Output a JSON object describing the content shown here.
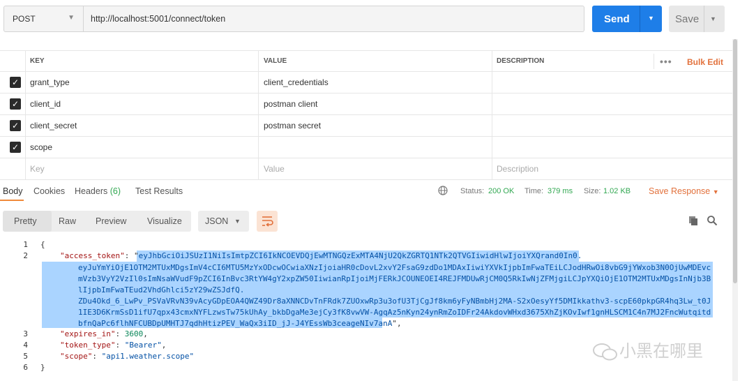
{
  "request": {
    "method": "POST",
    "url": "http://localhost:5001/connect/token",
    "send_label": "Send",
    "save_label": "Save"
  },
  "params": {
    "headers": {
      "key": "KEY",
      "value": "VALUE",
      "description": "DESCRIPTION",
      "bulk_edit": "Bulk Edit"
    },
    "rows": [
      {
        "key": "grant_type",
        "value": "client_credentials",
        "checked": true
      },
      {
        "key": "client_id",
        "value": "postman client",
        "checked": true
      },
      {
        "key": "client_secret",
        "value": "postman secret",
        "checked": true
      },
      {
        "key": "scope",
        "value": "",
        "checked": true
      }
    ],
    "placeholder": {
      "key": "Key",
      "value": "Value",
      "description": "Description"
    }
  },
  "response_tabs": {
    "body": "Body",
    "cookies": "Cookies",
    "headers": "Headers",
    "headers_count": "(6)",
    "test_results": "Test Results"
  },
  "response_status": {
    "status_label": "Status:",
    "status_value": "200 OK",
    "time_label": "Time:",
    "time_value": "379 ms",
    "size_label": "Size:",
    "size_value": "1.02 KB",
    "save_response": "Save Response"
  },
  "view_modes": {
    "pretty": "Pretty",
    "raw": "Raw",
    "preview": "Preview",
    "visualize": "Visualize",
    "format": "JSON"
  },
  "code": {
    "line1": "{",
    "k_access": "\"access_token\"",
    "colon_sp": ": \"",
    "tok1": "eyJhbGciOiJSUzI1NiIsImtpZCI6IkNCOEVDQjEwMTNGQzExMTA4NjU2QkZGRTQ1NTk2QTVGIiwidHlwIjoiYXQrand0In0.",
    "tok2": "eyJuYmYiOjE1OTM2MTUxMDgsImV4cCI6MTU5MzYxODcwOCwiaXNzIjoiaHR0cDovL2xvY2FsaG9zdDo1MDAxIiwiYXVkIjpbImFwaTEiLCJodHRwOi8vbG9jYWxob3N0OjUwMDEvcmVzb3VyY2VzIl0sImNsaWVudF9pZCI6InBvc3RtYW4gY2xpZW50IiwianRpIjoiMjFERkJCOUNEOEI4REJFMDUwRjCM0Q5RkIwNjZFMjgiLCJpYXQiOjE1OTM2MTUxMDgsInNjb3BlIjpbImFwaTEud2VhdGhlci5zY29wZSJdfQ.",
    "tok3": "ZDu4Okd_6_LwPv_PSVaVRvN39vAcyGDpEOA4QWZ49Dr8aXNNCDvTnFRdk7ZUOxwRp3u3ofU3TjCgJf8km6yFyNBmbHj2MA-S2xOesyYf5DMIkkathv3-scpE60pkpGR4hq3Lw_t0J1IE3D6KrmSsD1ifU7qpx43cmxNYFLzwsTw75kUhAy_bkbDgaMe3ejCy3fK8vwVW-AgqAz5nKyn24ynRmZoIDFr24AkdovWHxd3675XhZjKOvIwf1gnHLSCM1C4n7MJ2FncWutqitdbfnQaPc6flhNFCUBDpUMHTJ7qdhHtizPEV_WaQx3iID_jJ-J4YEssWb3ceageNIv7anA",
    "comma": "\",",
    "k_expires": "\"expires_in\"",
    "v_expires": "3600",
    "k_type": "\"token_type\"",
    "v_type": "\"Bearer\"",
    "k_scope": "\"scope\"",
    "v_scope": "\"api1.weather.scope\"",
    "line_last": "}",
    "line_numbers": [
      "1",
      "2",
      "3",
      "4",
      "5",
      "6"
    ]
  },
  "watermark": "小黑在哪里",
  "colors": {
    "accent": "#1e7ee8",
    "orange": "#e2713c",
    "ok_green": "#32a852"
  }
}
